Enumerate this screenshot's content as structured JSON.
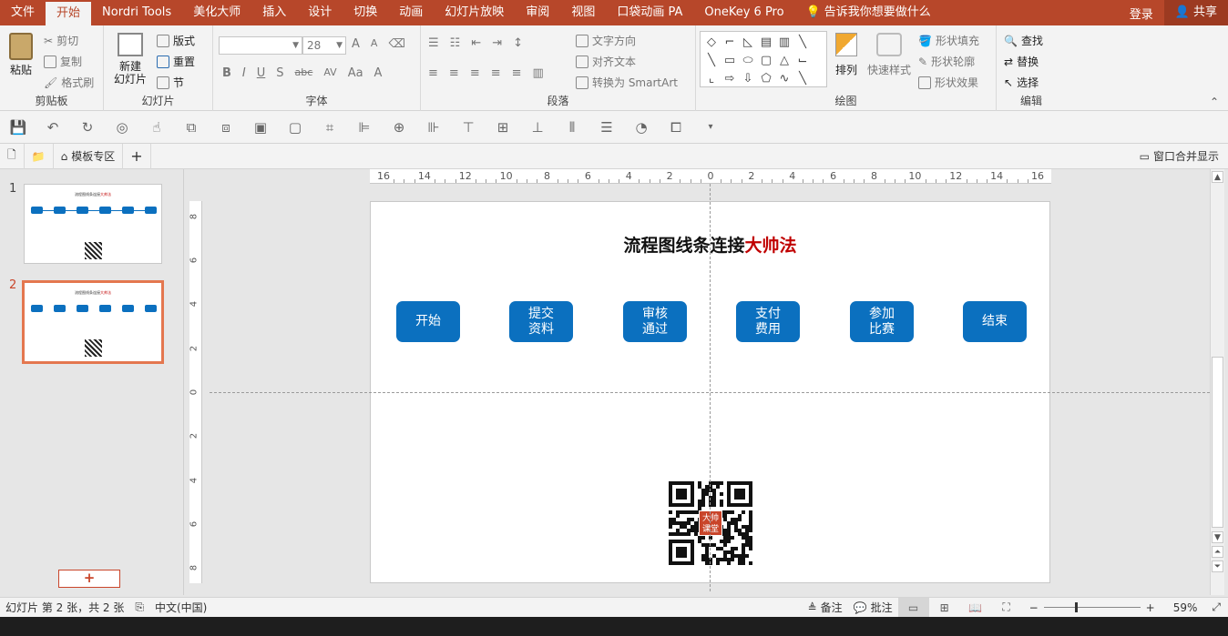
{
  "tabs": [
    {
      "id": "file",
      "label": "文件"
    },
    {
      "id": "home",
      "label": "开始"
    },
    {
      "id": "nordri",
      "label": "Nordri Tools"
    },
    {
      "id": "beautify",
      "label": "美化大师"
    },
    {
      "id": "insert",
      "label": "插入"
    },
    {
      "id": "design",
      "label": "设计"
    },
    {
      "id": "transitions",
      "label": "切换"
    },
    {
      "id": "animations",
      "label": "动画"
    },
    {
      "id": "slideshow",
      "label": "幻灯片放映"
    },
    {
      "id": "review",
      "label": "审阅"
    },
    {
      "id": "view",
      "label": "视图"
    },
    {
      "id": "pocket",
      "label": "口袋动画 PA"
    },
    {
      "id": "onekey",
      "label": "OneKey 6 Pro"
    }
  ],
  "tell_me": "告诉我你想要做什么",
  "account": {
    "login": "登录",
    "share": "共享"
  },
  "ribbon": {
    "clipboard": {
      "label": "剪贴板",
      "paste": "粘贴",
      "cut": "剪切",
      "copy": "复制",
      "format_painter": "格式刷"
    },
    "slides": {
      "label": "幻灯片",
      "new_slide_1": "新建",
      "new_slide_2": "幻灯片",
      "layout": "版式",
      "reset": "重置",
      "section": "节"
    },
    "font": {
      "label": "字体",
      "font_name": "",
      "font_size": "28",
      "bold": "B",
      "italic": "I",
      "underline": "U",
      "shadow": "S",
      "strike": "abc",
      "spacing": "AV",
      "case": "Aa",
      "color": "A",
      "grow": "A",
      "shrink": "A"
    },
    "paragraph": {
      "label": "段落",
      "text_direction": "文字方向",
      "align_text": "对齐文本",
      "smartart": "转换为 SmartArt"
    },
    "drawing": {
      "label": "绘图",
      "arrange": "排列",
      "quick_styles": "快速样式",
      "shape_fill": "形状填充",
      "shape_outline": "形状轮廓",
      "shape_effects": "形状效果"
    },
    "editing": {
      "label": "编辑",
      "find": "查找",
      "replace": "替换",
      "select": "选择"
    }
  },
  "docbar": {
    "template_zone": "模板专区",
    "add": "+",
    "merge_windows": "窗口合并显示"
  },
  "thumbnails": [
    {
      "number": "1",
      "title": "流程图线条连接",
      "title_highlight": "大帅法"
    },
    {
      "number": "2",
      "title": "流程图线条连接",
      "title_highlight": "大帅法"
    }
  ],
  "add_slide": "+",
  "ruler": {
    "horizontal": [
      "16",
      "14",
      "12",
      "10",
      "8",
      "6",
      "4",
      "2",
      "0",
      "2",
      "4",
      "6",
      "8",
      "10",
      "12",
      "14",
      "16"
    ],
    "vertical": [
      "8",
      "6",
      "4",
      "2",
      "0",
      "2",
      "4",
      "6",
      "8"
    ]
  },
  "slide": {
    "title": "流程图线条连接",
    "title_highlight": "大帅法",
    "boxes": [
      {
        "line1": "开始",
        "line2": ""
      },
      {
        "line1": "提交",
        "line2": "资料"
      },
      {
        "line1": "审核",
        "line2": "通过"
      },
      {
        "line1": "支付",
        "line2": "费用"
      },
      {
        "line1": "参加",
        "line2": "比赛"
      },
      {
        "line1": "结束",
        "line2": ""
      }
    ],
    "qr_badge_1": "大帅",
    "qr_badge_2": "课堂"
  },
  "status": {
    "slide_info": "幻灯片 第 2 张，共 2 张",
    "language": "中文(中国)",
    "notes": "备注",
    "comments": "批注",
    "zoom": "59%",
    "zoom_fraction": 0.59
  },
  "colors": {
    "accent": "#b7472a",
    "shape": "#0b70bf",
    "title_highlight": "#c00000"
  }
}
